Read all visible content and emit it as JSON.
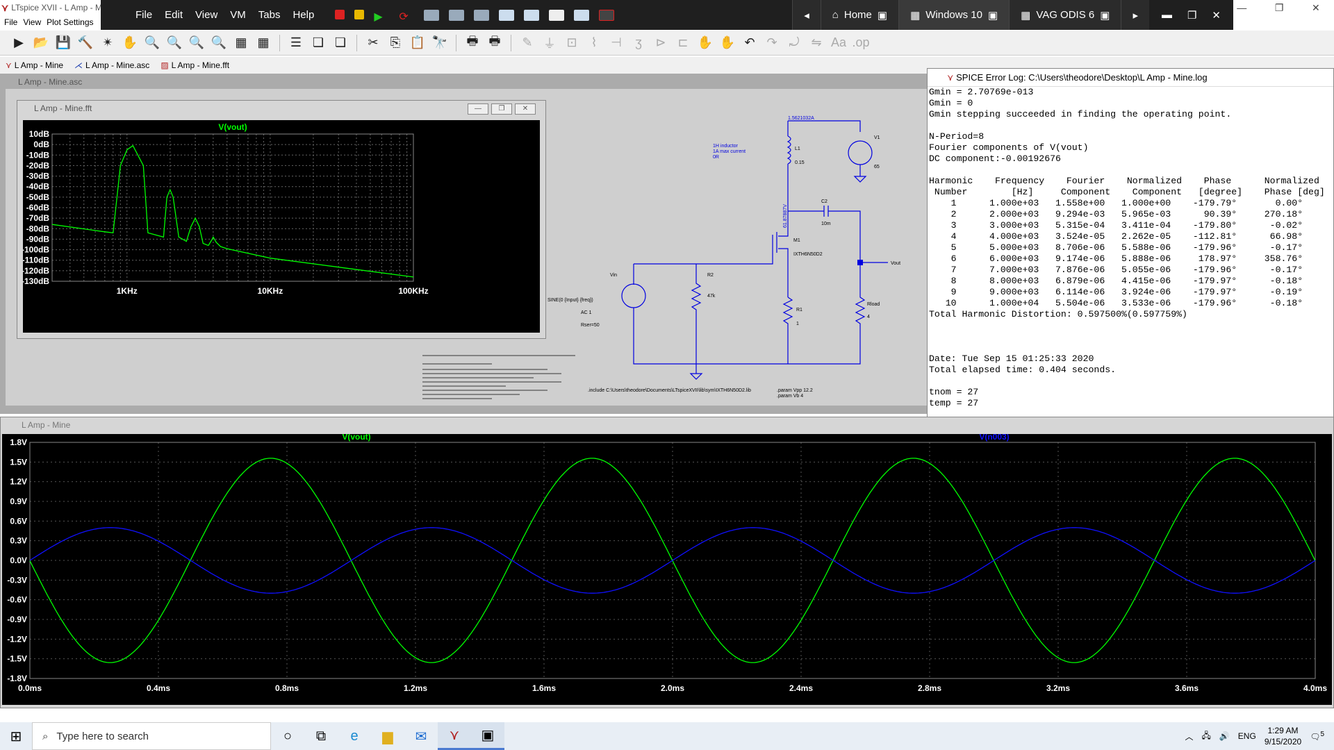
{
  "app": {
    "title": "LTspice XVII - L Amp - M",
    "menu": [
      "File",
      "View",
      "Plot Settings"
    ]
  },
  "vm": {
    "menu": [
      "File",
      "Edit",
      "View",
      "VM",
      "Tabs",
      "Help"
    ],
    "tabs": [
      {
        "label": "Home",
        "active": false
      },
      {
        "label": "Windows 10",
        "active": true
      },
      {
        "label": "VAG ODIS 6",
        "active": false
      }
    ]
  },
  "doctabs": [
    {
      "label": "L Amp - Mine"
    },
    {
      "label": "L Amp - Mine.asc"
    },
    {
      "label": "L Amp - Mine.fft"
    }
  ],
  "windows": {
    "asc_title": "L Amp - Mine.asc",
    "fft_title": "L Amp - Mine.fft",
    "wave_title": "L Amp - Mine",
    "errlog_title": "SPICE Error Log: C:\\Users\\theodore\\Desktop\\L Amp - Mine.log"
  },
  "schematic": {
    "labels": {
      "inductor_note1": "1H inductor",
      "inductor_note2": "1A max current",
      "inductor_note3": "0R",
      "l1": "L1",
      "l1_val": "0.15",
      "top_current": "1.5621032A",
      "v1": "V1",
      "v1_val": "65",
      "c2": "C2",
      "c2_val": "10m",
      "m1": "M1",
      "m1_part": "IXTH6N50D2",
      "vout": "Vout",
      "r2": "R2",
      "r2_val": "47k",
      "r1": "R1",
      "r1_val": "1",
      "rload": "Rload",
      "rload_val": "4",
      "vin": "Vin",
      "sine": "SINE(0 {Input} {freq})",
      "ac": "AC 1",
      "rser": "Rser=50",
      "drain_v": "61.87887V",
      "include": ".include C:\\Users\\theodore\\Documents\\LTspiceXVII\\lib\\sym\\IXTH6N50D2.lib",
      "param1": ".param Vpp 12.2",
      "param2": ".param Vb 4"
    }
  },
  "fft": {
    "trace_label": "V(vout)",
    "trace_color": "#00ff00",
    "y_ticks": [
      "10dB",
      "0dB",
      "-10dB",
      "-20dB",
      "-30dB",
      "-40dB",
      "-50dB",
      "-60dB",
      "-70dB",
      "-80dB",
      "-90dB",
      "-100dB",
      "-110dB",
      "-120dB",
      "-130dB"
    ],
    "x_ticks": [
      "1KHz",
      "10KHz",
      "100KHz"
    ]
  },
  "wave": {
    "trace1_label": "V(vout)",
    "trace1_color": "#00ff00",
    "trace2_label": "V(n003)",
    "trace2_color": "#1010ff",
    "y_ticks": [
      "1.8V",
      "1.5V",
      "1.2V",
      "0.9V",
      "0.6V",
      "0.3V",
      "0.0V",
      "-0.3V",
      "-0.6V",
      "-0.9V",
      "-1.2V",
      "-1.5V",
      "-1.8V"
    ],
    "x_ticks": [
      "0.0ms",
      "0.4ms",
      "0.8ms",
      "1.2ms",
      "1.6ms",
      "2.0ms",
      "2.4ms",
      "2.8ms",
      "3.2ms",
      "3.6ms",
      "4.0ms"
    ]
  },
  "chart_data": [
    {
      "type": "line",
      "title": "V(vout)",
      "xlabel": "",
      "ylabel": "",
      "x_scale": "log",
      "xlim": [
        300,
        100000
      ],
      "ylim": [
        -130,
        10
      ],
      "series": [
        {
          "name": "V(vout)",
          "x": [
            300,
            700,
            800,
            900,
            1000,
            1100,
            1300,
            1400,
            1800,
            1900,
            2000,
            2100,
            2300,
            2600,
            2800,
            3000,
            3200,
            3400,
            3700,
            3900,
            4000,
            4200,
            4500,
            5000,
            10000,
            100000
          ],
          "y": [
            -76,
            -83,
            -84,
            -20,
            -5,
            -1,
            -20,
            -84,
            -88,
            -50,
            -43,
            -50,
            -88,
            -92,
            -78,
            -70,
            -78,
            -94,
            -96,
            -91,
            -88,
            -93,
            -97,
            -99,
            -108,
            -126
          ]
        }
      ]
    },
    {
      "type": "line",
      "title": "",
      "xlabel": "",
      "ylabel": "",
      "xlim": [
        0,
        4.0
      ],
      "ylim": [
        -1.8,
        1.8
      ],
      "x_unit": "ms",
      "series": [
        {
          "name": "V(vout)",
          "amplitude": 1.558,
          "frequency_khz": 1.0,
          "phase_deg": -179.79
        },
        {
          "name": "V(n003)",
          "amplitude": 0.5,
          "frequency_khz": 1.0,
          "phase_deg": 0
        }
      ]
    }
  ],
  "errlog": {
    "lines": [
      "Gmin = 2.70769e-013",
      "Gmin = 0",
      "Gmin stepping succeeded in finding the operating point.",
      "",
      "N-Period=8",
      "Fourier components of V(vout)",
      "DC component:-0.00192676",
      "",
      "Harmonic    Frequency    Fourier    Normalized    Phase      Normalized",
      " Number        [Hz]     Component    Component   [degree]    Phase [deg]",
      "    1      1.000e+03   1.558e+00   1.000e+00    -179.79°       0.00°",
      "    2      2.000e+03   9.294e-03   5.965e-03      90.39°     270.18°",
      "    3      3.000e+03   5.315e-04   3.411e-04    -179.80°      -0.02°",
      "    4      4.000e+03   3.524e-05   2.262e-05    -112.81°      66.98°",
      "    5      5.000e+03   8.706e-06   5.588e-06    -179.96°      -0.17°",
      "    6      6.000e+03   9.174e-06   5.888e-06     178.97°     358.76°",
      "    7      7.000e+03   7.876e-06   5.055e-06    -179.96°      -0.17°",
      "    8      8.000e+03   6.879e-06   4.415e-06    -179.97°      -0.18°",
      "    9      9.000e+03   6.114e-06   3.924e-06    -179.97°      -0.19°",
      "   10      1.000e+04   5.504e-06   3.533e-06    -179.96°      -0.18°",
      "Total Harmonic Distortion: 0.597500%(0.597759%)",
      "",
      "",
      "",
      "Date: Tue Sep 15 01:25:33 2020",
      "Total elapsed time: 0.404 seconds.",
      "",
      "tnom = 27",
      "temp = 27"
    ]
  },
  "taskbar": {
    "search_placeholder": "Type here to search",
    "lang": "ENG",
    "time": "1:29 AM",
    "date": "9/15/2020",
    "notif_count": "5"
  }
}
